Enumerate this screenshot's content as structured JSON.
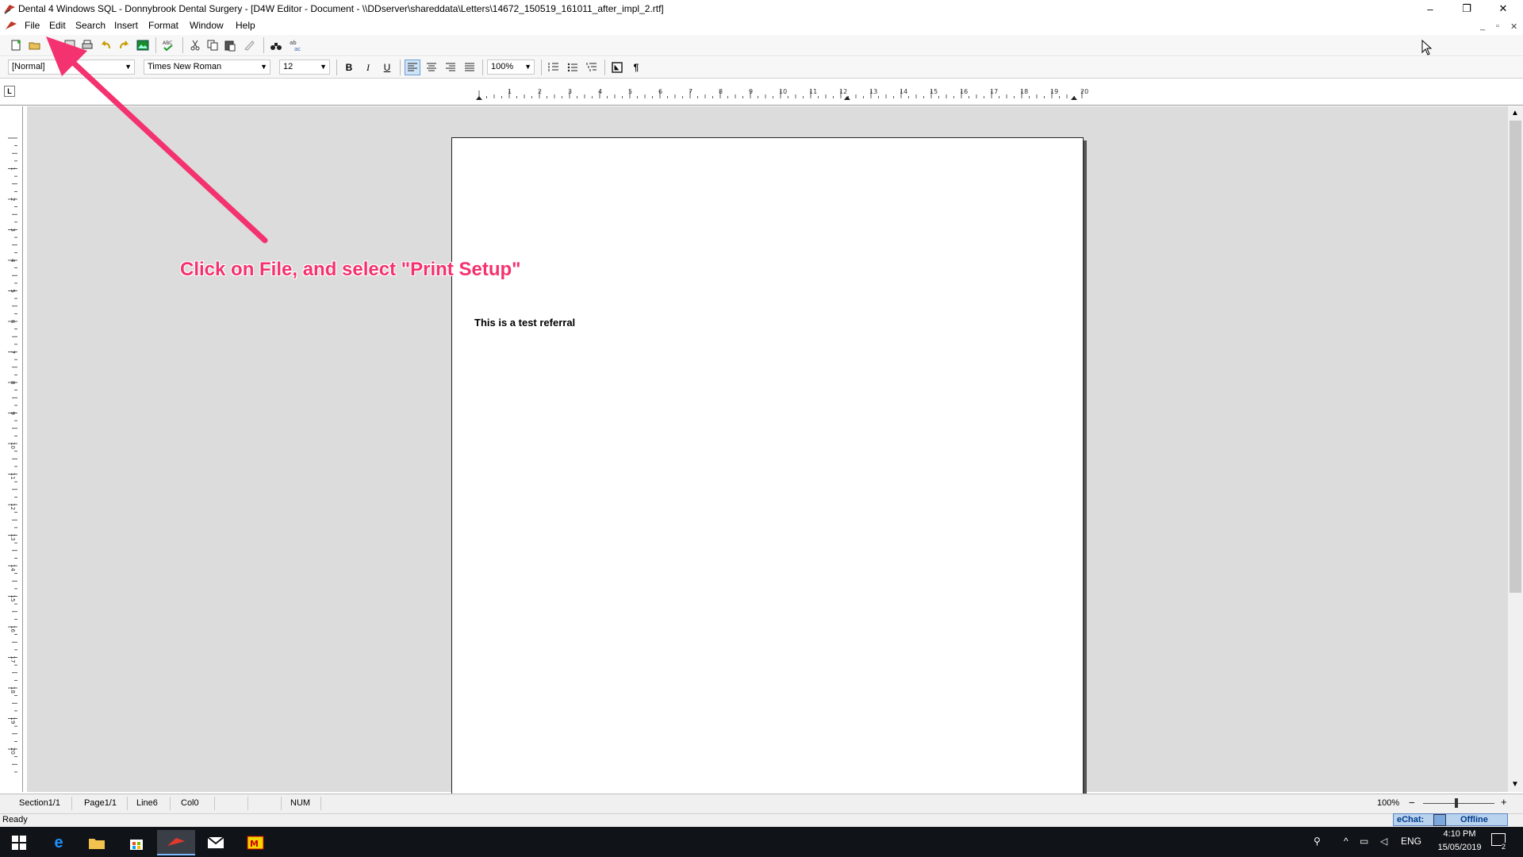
{
  "window": {
    "title": "Dental 4 Windows SQL - Donnybrook Dental Surgery - [D4W Editor - Document - \\\\DDserver\\shareddata\\Letters\\14672_150519_161011_after_impl_2.rtf]",
    "minimize_label": "–",
    "maximize_label": "❐",
    "close_label": "✕"
  },
  "menu": {
    "items": [
      {
        "label": "File"
      },
      {
        "label": "Edit"
      },
      {
        "label": "Search"
      },
      {
        "label": "Insert"
      },
      {
        "label": "Format"
      },
      {
        "label": "Window"
      },
      {
        "label": "Help"
      }
    ],
    "mdi_min": "_",
    "mdi_restore": "▫",
    "mdi_close": "✕"
  },
  "format_bar": {
    "style_value": "[Normal]",
    "font_value": "Times New Roman",
    "size_value": "12",
    "bold_label": "B",
    "italic_label": "I",
    "underline_label": "U",
    "zoom_value": "100%",
    "pilcrow_label": "¶"
  },
  "ruler": {
    "tab_selector_label": "L",
    "h_numbers": [
      "1",
      "2",
      "3",
      "4",
      "5",
      "6",
      "7",
      "8",
      "9",
      "10",
      "11",
      "12",
      "13",
      "14",
      "15",
      "16",
      "17",
      "18",
      "19",
      "20"
    ],
    "v_numbers": [
      "1",
      "2",
      "3",
      "4",
      "5",
      "6",
      "7",
      "8",
      "9",
      "10",
      "11",
      "12",
      "13",
      "14",
      "15",
      "16",
      "17",
      "18",
      "19",
      "20"
    ]
  },
  "document": {
    "body_text": "This is a test referral"
  },
  "status": {
    "section": "Section1/1",
    "page": "Page1/1",
    "line": "Line6",
    "col": "Col0",
    "num": "NUM",
    "zoom": "100%",
    "zoom_minus": "−",
    "zoom_plus": "+",
    "ready": "Ready",
    "echat_label": "eChat:",
    "echat_status": "Offline"
  },
  "taskbar": {
    "language": "ENG",
    "time": "4:10 PM",
    "date": "15/05/2019",
    "notification_count": "2"
  },
  "annotation": {
    "text": "Click on File, and select \"Print Setup\""
  },
  "colors": {
    "annotation": "#f3326f",
    "taskbar": "#101418",
    "workspace": "#dcdcdc",
    "echat_bg": "#b9d3ef"
  }
}
